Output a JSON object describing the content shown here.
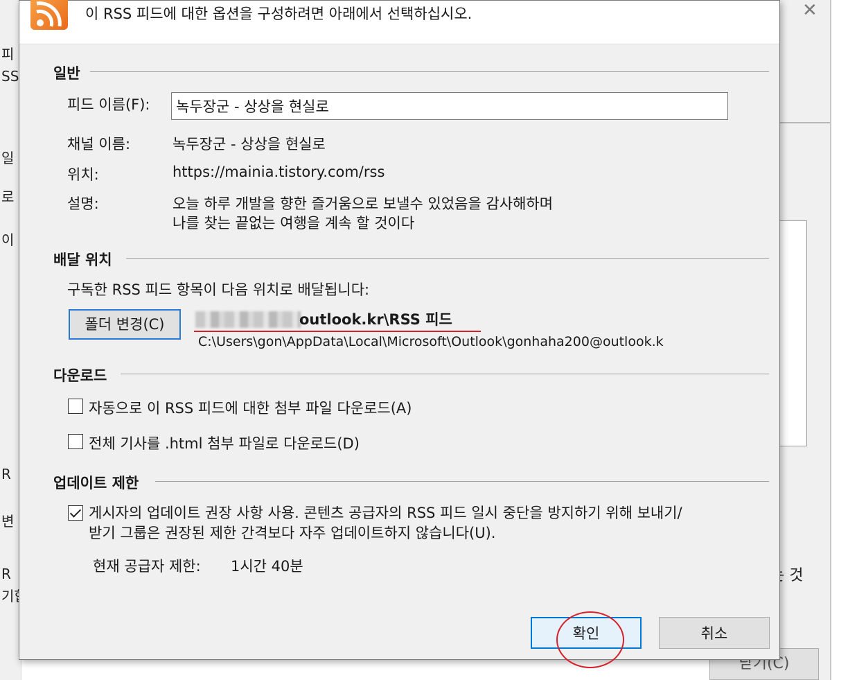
{
  "background": {
    "left_fragments": [
      "피",
      "SS",
      "일",
      "로",
      "이",
      "R",
      "변",
      "R",
      "기합"
    ],
    "right_fragment": "는 것",
    "close_button_label": "닫기(C)"
  },
  "header": {
    "text": "이 RSS 피드에 대한 옵션을 구성하려면 아래에서 선택하십시오."
  },
  "general": {
    "title": "일반",
    "feed_name_label": "피드 이름(F):",
    "feed_name_value": "녹두장군 - 상상을 현실로",
    "channel_name_label": "채널 이름:",
    "channel_name_value": "녹두장군 - 상상을 현실로",
    "location_label": "위치:",
    "location_value": "https://mainia.tistory.com/rss",
    "description_label": "설명:",
    "description_line1": "오늘 하루 개발을 향한 즐거움으로 보낼수 있었음을 감사해하며",
    "description_line2": "나를 찾는 끝없는 여행을 계속 할 것이다"
  },
  "delivery": {
    "title": "배달 위치",
    "info_text": "구독한 RSS 피드 항목이 다음 위치로 배달됩니다:",
    "change_folder_button": "폴더 변경(C)",
    "folder_name": "outlook.kr\\RSS 피드",
    "folder_path": "C:\\Users\\gon\\AppData\\Local\\Microsoft\\Outlook\\gonhaha200@outlook.k"
  },
  "download": {
    "title": "다운로드",
    "auto_attachments_label": "자동으로 이 RSS 피드에 대한 첨부 파일 다운로드(A)",
    "auto_attachments_checked": false,
    "full_article_label": "전체 기사를 .html 첨부 파일로 다운로드(D)",
    "full_article_checked": false
  },
  "update_limit": {
    "title": "업데이트 제한",
    "use_publisher_label_line1": "게시자의 업데이트 권장 사항 사용. 콘텐츠 공급자의 RSS 피드 일시 중단을 방지하기 위해 보내기/",
    "use_publisher_label_line2": "받기 그룹은 권장된 제한 간격보다 자주 업데이트하지 않습니다(U).",
    "use_publisher_checked": true,
    "current_limit_label": "현재 공급자 제한:",
    "current_limit_value": "1시간 40분"
  },
  "buttons": {
    "ok": "확인",
    "cancel": "취소"
  },
  "colors": {
    "dialog_bg": "#f0f0f0",
    "accent_blue": "#0078d7",
    "annotation_red": "#d6202a",
    "rss_orange": "#ea6a1a"
  }
}
